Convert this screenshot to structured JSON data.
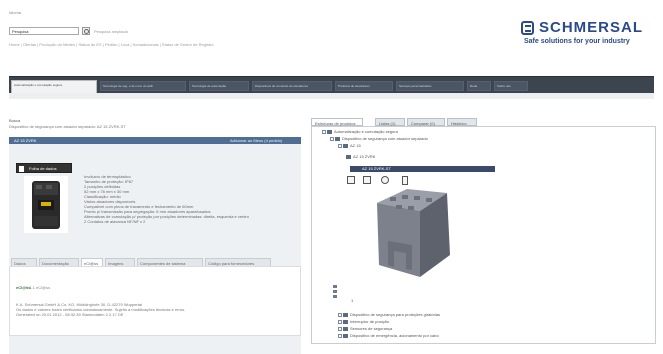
{
  "header": {
    "top_link": "Idioma",
    "search_value": "Pesquisa",
    "advanced_search": "Pesquisa ampliada",
    "quicklinks": "Home | Ofertas | Produção do Medes | Status do ES | Pedido | Loca | Somadicionais | Status de Gestor de Registro",
    "logo_name": "SCHMERSAL",
    "logo_tagline": "Safe solutions for your industry"
  },
  "nav": {
    "tabs": [
      {
        "label": "Automatização e comutação segura"
      },
      {
        "label": "Tecnologia de seg. e de mod. do atrib"
      },
      {
        "label": "Tecnologia de automação"
      },
      {
        "label": "Dispositivos de comando de elevadores"
      },
      {
        "label": "Produtos de elevadores"
      },
      {
        "label": "Serviços personalizados"
      },
      {
        "label": "Rede"
      },
      {
        "label": "Sobre nós"
      }
    ]
  },
  "content": {
    "title": "Busca",
    "subtitle": "Dispositivo de segurança com atuador separado: AZ 15 ZVRK-ST"
  },
  "product": {
    "code": "AZ 15 ZVRK",
    "header_link": "Adicionar ao Meus (4 pedido)",
    "datasheet_label": "Folha de dados",
    "features": [
      "Invólucro de termoplástico",
      "Tamanho de proteção: IP67",
      "2 posições definidas",
      "52 mm x 78 mm x 30 mm",
      "Classificação: médio",
      "Vários atuadores disponíveis",
      "Compatível com pinos de travamento e fechamento de 60mm",
      "Pronto p/ transmissão para segregação: 6 mm atuadores aparafusados",
      "Alternativas de comutação p/ proteção por posições determinadas: direita, esquerda e centro",
      "2 Contatos de alavanca NF/NF x 2"
    ],
    "detail_tabs": [
      {
        "label": "Dados"
      },
      {
        "label": "Documentação"
      },
      {
        "label": "eCl@ss"
      },
      {
        "label": "Imagens"
      },
      {
        "label": "Componentes de sistema"
      },
      {
        "label": "Código para fornecedores"
      }
    ],
    "eclass_logo": "eCl@ss",
    "eclass_text": "5.1.1 eCl@ss",
    "footer_lines": [
      "K.A. Schmersal GmbH & Co. KG, Möddinghofe 30, D-42279 Wuppertal",
      "Os dados e valores foram verificados cuidadosamente. Sujeito a modificações técnicas e erros.",
      "Generated on 20.01.2012 - 08:32:39 Stammdaten 2.2.17 DE"
    ]
  },
  "right_panel": {
    "tabs": [
      {
        "label": "Estruturas de produtos"
      },
      {
        "label": "Listas (1)"
      },
      {
        "label": "Comparar (0)"
      },
      {
        "label": "Histórico"
      }
    ],
    "tree": [
      {
        "label": "Automatização e comutação segura"
      },
      {
        "label": "Dispositivo de segurança com atuador separado"
      },
      {
        "label": "AZ 15"
      },
      {
        "label": "AZ 15 ZVRK"
      },
      {
        "label": "AZ 15 ZVRK-ST"
      },
      {
        "label": "Dispositivo de segurança para proteções giratórias"
      },
      {
        "label": "Interruptor de posição"
      },
      {
        "label": "Sensores de segurança"
      },
      {
        "label": "Dispositivo de emergência, acionamento por cabo"
      }
    ],
    "viewer_footer": "1"
  }
}
